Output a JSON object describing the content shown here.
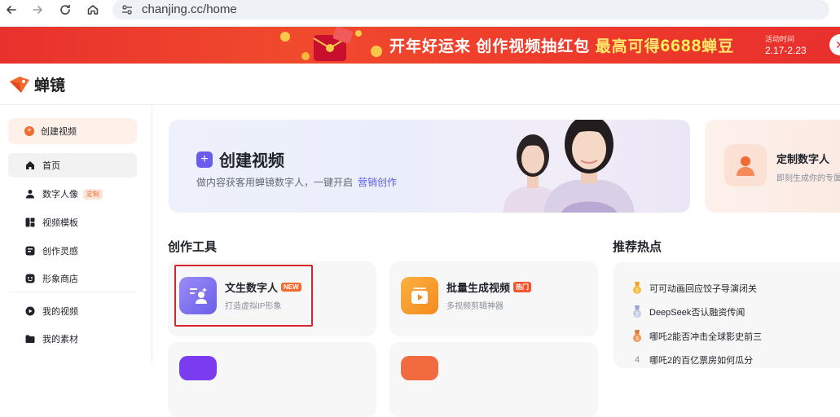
{
  "browser": {
    "url": "chanjing.cc/home"
  },
  "banner": {
    "text_part1": "开年好运来 创作视频抽红包 ",
    "text_part2": "最高可得",
    "amount": "6688",
    "unit": "蝉豆",
    "time_label": "活动时间",
    "time_value": "2.17-2.23"
  },
  "app": {
    "logo_text": "蝉镜"
  },
  "sidebar": {
    "create_label": "创建视频",
    "items": [
      {
        "label": "首页",
        "icon": "home-icon",
        "active": true
      },
      {
        "label": "数字人像",
        "icon": "person-icon",
        "badge": "定制"
      },
      {
        "label": "视频模板",
        "icon": "template-icon"
      },
      {
        "label": "创作灵感",
        "icon": "inspiration-icon"
      },
      {
        "label": "形象商店",
        "icon": "store-icon"
      },
      {
        "label": "我的视频",
        "icon": "play-icon"
      },
      {
        "label": "我的素材",
        "icon": "folder-icon"
      }
    ]
  },
  "hero": {
    "title": "创建视频",
    "subtitle": "做内容获客用蝉镜数字人，一键开启",
    "link": "营销创作"
  },
  "custom_card": {
    "title": "定制数字人",
    "subtitle": "即刻生成你的专属"
  },
  "sections": {
    "tools_title": "创作工具",
    "hot_title": "推荐热点"
  },
  "tools": [
    {
      "name": "文生数字人",
      "badge": "NEW",
      "sub": "打造虚拟IP形象"
    },
    {
      "name": "批量生成视频",
      "badge": "热门",
      "sub": "多视频剪辑神器"
    }
  ],
  "hot_topics": [
    {
      "text": "可可动画回应饺子导演闭关",
      "rank_icon": "rank-1-medal-icon"
    },
    {
      "text": "DeepSeek否认融资传闻",
      "rank_icon": "rank-2-medal-icon"
    },
    {
      "text": "哪吒2能否冲击全球影史前三",
      "rank_icon": "rank-3-medal-icon"
    },
    {
      "text": "哪吒2的百亿票房如何瓜分",
      "rank_icon": "rank-4-icon",
      "rank": "4"
    }
  ],
  "colors": {
    "accent": "#f26a2f",
    "banner_red": "#e8312d",
    "purple": "#6b5cf0",
    "highlight_red": "#d7232b"
  }
}
